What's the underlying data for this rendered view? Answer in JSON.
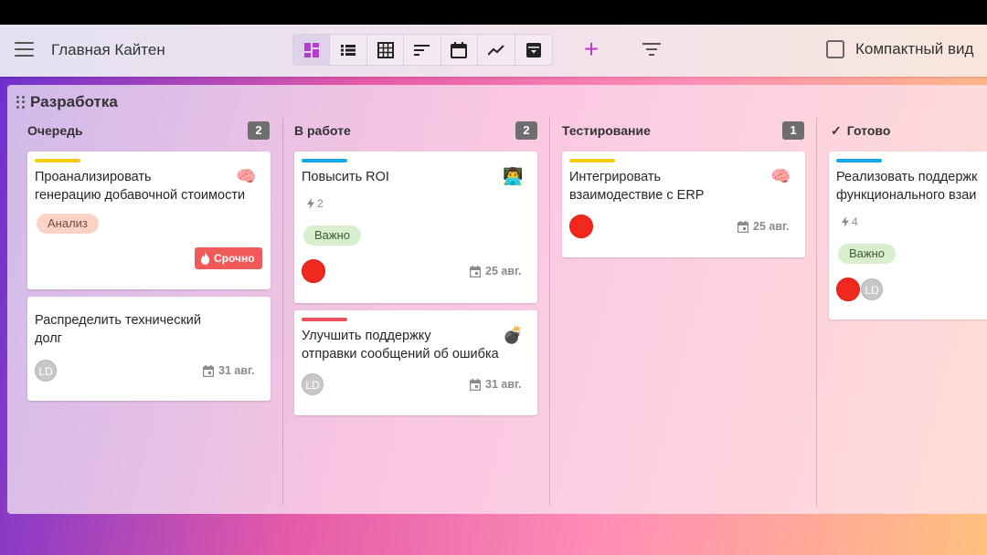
{
  "header": {
    "title": "Главная Кайтен",
    "views": [
      "dashboard-icon",
      "list-icon",
      "table-icon",
      "sort-icon",
      "calendar-icon",
      "chart-line-icon",
      "archive-icon"
    ],
    "compact_label": "Компактный вид"
  },
  "colors": {
    "accent": "#b43ccf",
    "urgent": "#f25a5a",
    "stripe_yellow": "#f7cb11",
    "stripe_blue": "#18a8ea",
    "stripe_red": "#e9505a"
  },
  "board": {
    "title": "Разработка",
    "columns": [
      {
        "title": "Очередь",
        "count": "2"
      },
      {
        "title": "В работе",
        "count": "2"
      },
      {
        "title": "Тестирование",
        "count": "1"
      },
      {
        "title": "Готово",
        "check": "✓"
      }
    ]
  },
  "cards": {
    "c1": {
      "line1": "Проанализировать",
      "line2": "генерацию добавочной стоимости",
      "emoji": "🧠",
      "tag": "Анализ",
      "urgent": "Срочно"
    },
    "c2": {
      "line1": "Распределить технический",
      "line2": "долг",
      "avatar": "LD",
      "date": "31 авг."
    },
    "c3": {
      "line1": "Повысить ROI",
      "emoji": "👨‍💻",
      "bolt": "2",
      "tag": "Важно",
      "date": "25 авг."
    },
    "c4": {
      "line1": "Улучшить поддержку",
      "line2": "отправки сообщений об ошибка",
      "emoji": "💣",
      "avatar": "LD",
      "date": "31 авг."
    },
    "c5": {
      "line1": "Интегрировать",
      "line2": "взаимодествие с ERP",
      "emoji": "🧠",
      "date": "25 авг."
    },
    "c6": {
      "line1": "Реализовать поддержк",
      "line2": "функционального взаи",
      "bolt": "4",
      "tag": "Важно",
      "avatar": "LD"
    }
  }
}
